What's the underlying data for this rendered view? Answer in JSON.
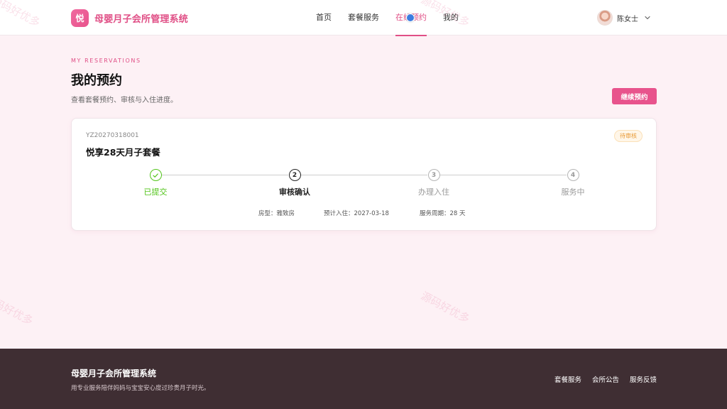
{
  "header": {
    "logo_text": "悦",
    "brand_name": "母婴月子会所管理系统",
    "nav": [
      {
        "label": "首页"
      },
      {
        "label": "套餐服务"
      },
      {
        "label": "在线预约"
      },
      {
        "label": "我的"
      }
    ],
    "active_nav": "在线预约",
    "user_name": "陈女士"
  },
  "main": {
    "eyebrow": "MY RESERVATIONS",
    "title": "我的预约",
    "subtitle": "查看套餐预约、审核与入住进度。",
    "continue_label": "继续预约"
  },
  "reservation": {
    "order_no": "YZ20270318001",
    "package_name": "悦享28天月子套餐",
    "status": "待审核",
    "steps": [
      {
        "num": "1",
        "label": "已提交",
        "state": "done"
      },
      {
        "num": "2",
        "label": "审核确认",
        "state": "current"
      },
      {
        "num": "3",
        "label": "办理入住",
        "state": "pending"
      },
      {
        "num": "4",
        "label": "服务中",
        "state": "pending"
      }
    ],
    "room_type": "房型：雅致房",
    "checkin": "预计入住：2027-03-18",
    "period": "服务周期：28 天"
  },
  "watermark": "源码好优多",
  "footer": {
    "title": "母婴月子会所管理系统",
    "description": "用专业服务陪伴妈妈与宝宝安心度过珍贵月子时光。",
    "links": [
      {
        "label": "套餐服务"
      },
      {
        "label": "会所公告"
      },
      {
        "label": "服务反馈"
      }
    ]
  },
  "colors": {
    "accent": "#e8538c",
    "done": "#52c41a",
    "pending_badge": "#e89a36",
    "footer_bg": "#3f2e33"
  }
}
